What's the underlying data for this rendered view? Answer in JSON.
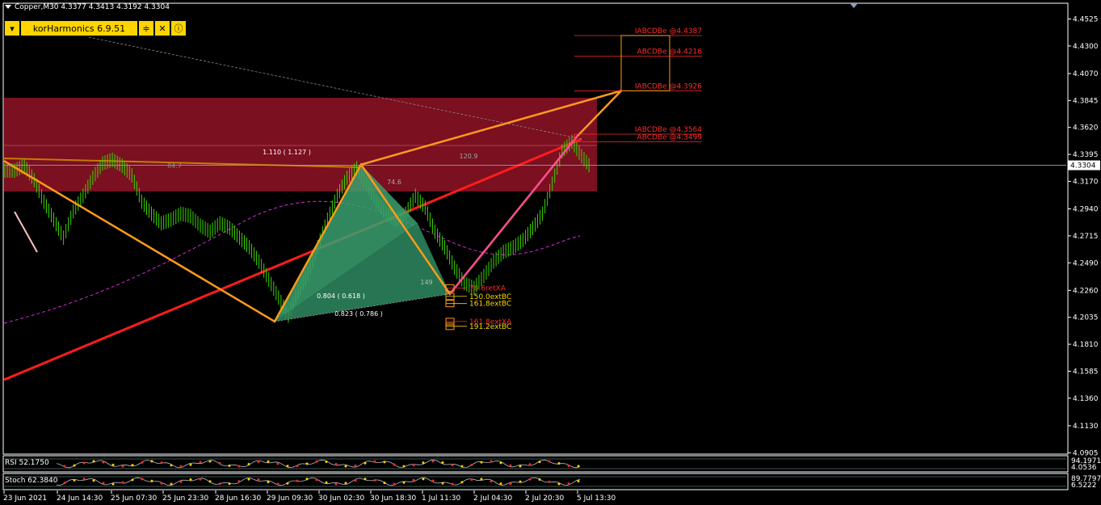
{
  "header": {
    "symbol_line": "Copper,M30  4.3377 4.3413 4.3192 4.3304"
  },
  "indicator_panel": {
    "name": "korHarmonics 6.9.51",
    "icons": [
      "chevron-down-icon",
      "sliders-icon",
      "tools-icon",
      "info-icon"
    ]
  },
  "chart_data": {
    "type": "line",
    "symbol": "Copper",
    "timeframe": "M30",
    "ohlc": {
      "open": 4.3377,
      "high": 4.3413,
      "low": 4.3192,
      "close": 4.3304
    },
    "ylim": [
      4.09,
      4.465
    ],
    "y_ticks": [
      "4.4525",
      "4.4300",
      "4.4070",
      "4.3845",
      "4.3620",
      "4.3395",
      "4.3170",
      "4.2940",
      "4.2715",
      "4.2490",
      "4.2260",
      "4.2035",
      "4.1810",
      "4.1585",
      "4.1360",
      "4.1130",
      "4.0905"
    ],
    "current_price_label": "4.3304",
    "x_ticks": [
      "23 Jun 2021",
      "24 Jun 14:30",
      "25 Jun 07:30",
      "25 Jun 23:30",
      "28 Jun 16:30",
      "29 Jun 09:30",
      "30 Jun 02:30",
      "30 Jun 18:30",
      "1 Jul 11:30",
      "2 Jul 04:30",
      "2 Jul 20:30",
      "5 Jul 13:30"
    ],
    "price_series": [
      4.326,
      4.33,
      4.318,
      4.3,
      4.285,
      4.27,
      4.292,
      4.305,
      4.32,
      4.332,
      4.335,
      4.33,
      4.322,
      4.3,
      4.29,
      4.282,
      4.285,
      4.29,
      4.288,
      4.28,
      4.275,
      4.282,
      4.278,
      4.27,
      4.262,
      4.25,
      4.235,
      4.22,
      4.205,
      4.225,
      4.24,
      4.262,
      4.285,
      4.305,
      4.32,
      4.328,
      4.315,
      4.3,
      4.29,
      4.285,
      4.29,
      4.305,
      4.295,
      4.275,
      4.262,
      4.245,
      4.232,
      4.228,
      4.238,
      4.25,
      4.258,
      4.262,
      4.268,
      4.278,
      4.29,
      4.315,
      4.342,
      4.35,
      4.338,
      4.328
    ],
    "pattern_points": [
      {
        "t": "23 Jun 2021",
        "price": 4.334
      },
      {
        "t": "29 Jun 09:30",
        "price": 4.2
      },
      {
        "t": "30 Jun 02:30",
        "price": 4.331
      },
      {
        "t": "1 Jul 11:30",
        "price": 4.223
      },
      {
        "t": "5 Jul 13:30",
        "price": 4.355
      }
    ],
    "ratio_labels": [
      "1.110 ( 1.127 )",
      "120.9",
      "74.6",
      "0.804 ( 0.618 )",
      "0.823 ( 0.786 )",
      "149",
      "84.7"
    ],
    "target_levels": [
      {
        "label": "IABCDBe  @4.4387",
        "price": 4.4387
      },
      {
        "label": "ABCDBe  @4.4216",
        "price": 4.4216
      },
      {
        "label": "IABCDBe  @4.3926",
        "price": 4.3926
      },
      {
        "label": "IABCDBe  @4.3564",
        "price": 4.3564
      },
      {
        "label": "ABCDBe  @4.3499",
        "price": 4.3499
      }
    ],
    "extension_labels": [
      {
        "label": "78.6retXA",
        "price": 4.228,
        "color": "#ff2a2a"
      },
      {
        "label": "150.0extBC",
        "price": 4.221,
        "color": "#ffd400"
      },
      {
        "label": "161.8extBC",
        "price": 4.215,
        "color": "#ffd400"
      },
      {
        "label": "161.8extXA",
        "price": 4.2,
        "color": "#ff2a2a"
      },
      {
        "label": "191.2extBC",
        "price": 4.196,
        "color": "#ffd400"
      }
    ],
    "rsi": {
      "label": "RSI 52.1750",
      "ticks": [
        "94.1971",
        "4.0536"
      ]
    },
    "stoch": {
      "label": "Stoch 62.3840",
      "ticks": [
        "89.7797",
        "6.5222"
      ]
    }
  }
}
